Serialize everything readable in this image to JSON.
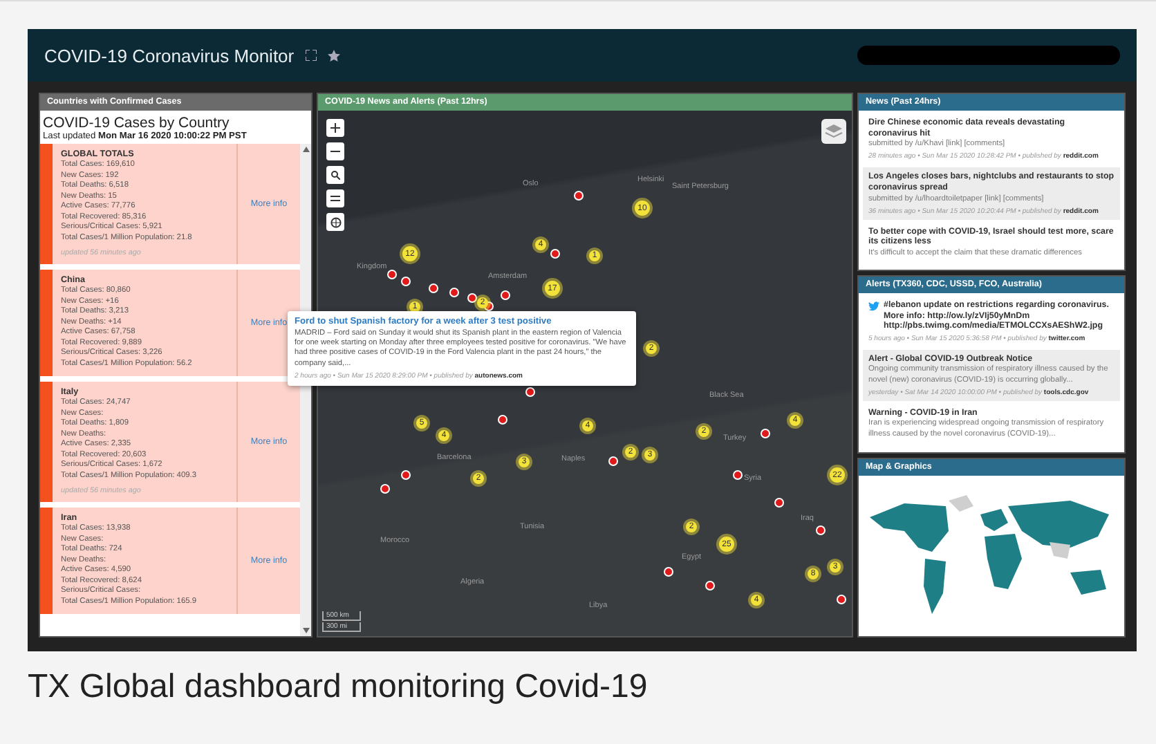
{
  "dashboard": {
    "title": "COVID-19 Coronavirus Monitor"
  },
  "countries_panel": {
    "header": "Countries with Confirmed Cases",
    "title": "COVID-19 Cases by Country",
    "last_updated_label": "Last updated",
    "last_updated": "Mon Mar 16 2020 10:00:22 PM PST",
    "cards": [
      {
        "name": "GLOBAL TOTALS",
        "stats": [
          "Total Cases: 169,610",
          "New Cases: 192",
          "Total Deaths: 6,518",
          "New Deaths: 15",
          "Active Cases: 77,776",
          "Total Recovered: 85,316",
          "Serious/Critical Cases: 5,921",
          "Total Cases/1 Million Population: 21.8"
        ],
        "link": "More info",
        "updated": "updated 56 minutes ago"
      },
      {
        "name": "China",
        "stats": [
          "Total Cases: 80,860",
          "New Cases: +16",
          "Total Deaths: 3,213",
          "New Deaths: +14",
          "Active Cases: 67,758",
          "Total Recovered: 9,889",
          "Serious/Critical Cases: 3,226",
          "Total Cases/1 Million Population: 56.2"
        ],
        "link": "More info"
      },
      {
        "name": "Italy",
        "stats": [
          "Total Cases: 24,747",
          "New Cases:",
          "Total Deaths: 1,809",
          "New Deaths:",
          "Active Cases: 2,335",
          "Total Recovered: 20,603",
          "Serious/Critical Cases: 1,672",
          "Total Cases/1 Million Population: 409.3"
        ],
        "link": "More info",
        "updated": "updated 56 minutes ago"
      },
      {
        "name": "Iran",
        "stats": [
          "Total Cases: 13,938",
          "New Cases:",
          "Total Deaths: 724",
          "New Deaths:",
          "Active Cases: 4,590",
          "Total Recovered: 8,624",
          "Serious/Critical Cases:",
          "Total Cases/1 Million Population: 165.9"
        ],
        "link": "More info"
      }
    ]
  },
  "map_panel": {
    "header": "COVID-19 News and Alerts (Past 12hrs)",
    "labels": [
      "Oslo",
      "Helsinki",
      "Saint Petersburg",
      "Kingdom",
      "Amsterdam",
      "Black Sea",
      "Barcelona",
      "Naples",
      "Turkey",
      "Syria",
      "Tunisia",
      "Iraq",
      "Morocco",
      "Egypt",
      "Algeria",
      "Libya"
    ],
    "markers": [
      "12",
      "10",
      "4",
      "17",
      "2",
      "1",
      "1",
      "4",
      "5",
      "2",
      "3",
      "4",
      "2",
      "3",
      "2",
      "4",
      "2",
      "25",
      "22",
      "8",
      "3",
      "4",
      "2"
    ],
    "scale": [
      "500 km",
      "300 mi"
    ],
    "popup": {
      "title": "Ford to shut Spanish factory for a week after 3 test positive",
      "body": "MADRID – Ford said on Sunday it would shut its Spanish plant in the eastern region of Valencia for one week starting on Monday after three employees tested positive for coronavirus. \"We have had three positive cases of COVID-19 in the Ford Valencia plant in the past 24 hours,\" the company said,...",
      "meta": "2 hours ago • Sun Mar 15 2020 8:29:00 PM • published by **autonews.com**"
    }
  },
  "news_panel": {
    "header": "News (Past 24hrs)",
    "items": [
      {
        "title": "Dire Chinese economic data reveals devastating coronavirus hit",
        "body": "submitted by /u/Khavi [link] [comments]",
        "meta": "28 minutes ago • Sun Mar 15 2020 10:28:42 PM • published by **reddit.com**",
        "highlighted": false
      },
      {
        "title": "Los Angeles closes bars, nightclubs and restaurants to stop coronavirus spread",
        "body": "submitted by /u/lhoardtoiletpaper [link] [comments]",
        "meta": "36 minutes ago • Sun Mar 15 2020 10:20:44 PM • published by **reddit.com**",
        "highlighted": true
      },
      {
        "title": "To better cope with COVID-19, Israel should test more, scare its citizens less",
        "body": "It's difficult to accept the claim that these dramatic differences",
        "highlighted": false
      }
    ]
  },
  "alerts_panel": {
    "header": "Alerts (TX360, CDC, USSD, FCO, Australia)",
    "items": [
      {
        "kind": "tweet",
        "title": "#lebanon update on restrictions regarding coronavirus. More info: http://ow.ly/zVIj50yMnDm http://pbs.twimg.com/media/ETMOLCCXsAEShW2.jpg",
        "meta": "5 hours ago • Sun Mar 15 2020 5:36:58 PM • published by **twitter.com**",
        "highlighted": false
      },
      {
        "kind": "alert",
        "title": "Alert - Global COVID-19 Outbreak Notice",
        "body": "Ongoing community transmission of respiratory illness caused by the novel (new) coronavirus (COVID-19) is occurring globally...",
        "meta": "yesterday • Sat Mar 14 2020 10:00:00 PM • published by **tools.cdc.gov**",
        "highlighted": true
      },
      {
        "kind": "alert",
        "title": "Warning - COVID-19 in Iran",
        "body": "Iran is experiencing widespread ongoing transmission of respiratory illness caused by the novel coronavirus (COVID-19)...",
        "highlighted": false
      }
    ]
  },
  "graphics_panel": {
    "header": "Map & Graphics"
  },
  "caption": "TX Global dashboard monitoring Covid-19"
}
